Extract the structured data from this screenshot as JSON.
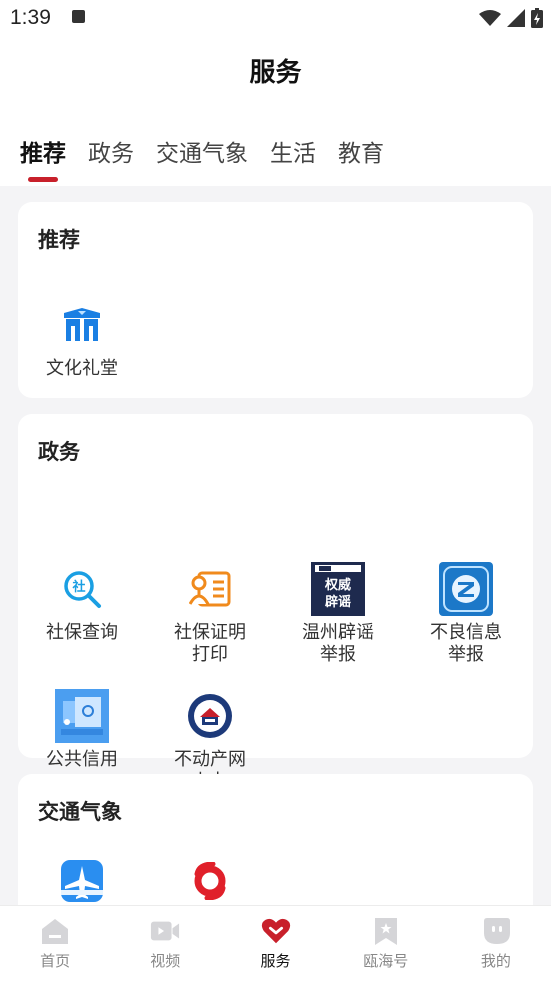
{
  "status_bar": {
    "time": "1:39"
  },
  "header": {
    "title": "服务"
  },
  "tabs": [
    {
      "label": "推荐",
      "active": true
    },
    {
      "label": "政务",
      "active": false
    },
    {
      "label": "交通气象",
      "active": false
    },
    {
      "label": "生活",
      "active": false
    },
    {
      "label": "教育",
      "active": false
    }
  ],
  "sections": {
    "recommend": {
      "title": "推荐",
      "items": [
        {
          "label": "文化礼堂",
          "icon": "culture-hall-icon"
        }
      ]
    },
    "government": {
      "title": "政务",
      "items": [
        {
          "label": "社保查询",
          "icon": "social-security-search-icon"
        },
        {
          "label": "社保证明打印",
          "line1": "社保证明",
          "line2": "打印",
          "icon": "id-card-icon"
        },
        {
          "label": "温州辟谣举报",
          "line1": "温州辟谣",
          "line2": "举报",
          "icon": "rumor-report-icon",
          "icon_text1": "权威",
          "icon_text2": "辟谣"
        },
        {
          "label": "不良信息举报",
          "line1": "不良信息",
          "line2": "举报",
          "icon": "bad-info-report-icon"
        },
        {
          "label": "公共信用",
          "icon": "public-credit-icon"
        },
        {
          "label": "不动产网上办",
          "line1": "不动产网",
          "line2": "上办",
          "icon": "real-estate-seal-icon"
        }
      ]
    },
    "traffic": {
      "title": "交通气象",
      "items": [
        {
          "icon": "airplane-icon"
        },
        {
          "icon": "typhoon-icon"
        }
      ]
    }
  },
  "bottom_nav": [
    {
      "label": "首页",
      "icon": "home-icon",
      "active": false
    },
    {
      "label": "视频",
      "icon": "video-icon",
      "active": false
    },
    {
      "label": "服务",
      "icon": "heart-icon",
      "active": true
    },
    {
      "label": "瓯海号",
      "icon": "bookmark-icon",
      "active": false
    },
    {
      "label": "我的",
      "icon": "profile-icon",
      "active": false
    }
  ],
  "colors": {
    "accent": "#c8202b",
    "blue": "#1a7fe3",
    "orange": "#f08a1c"
  }
}
